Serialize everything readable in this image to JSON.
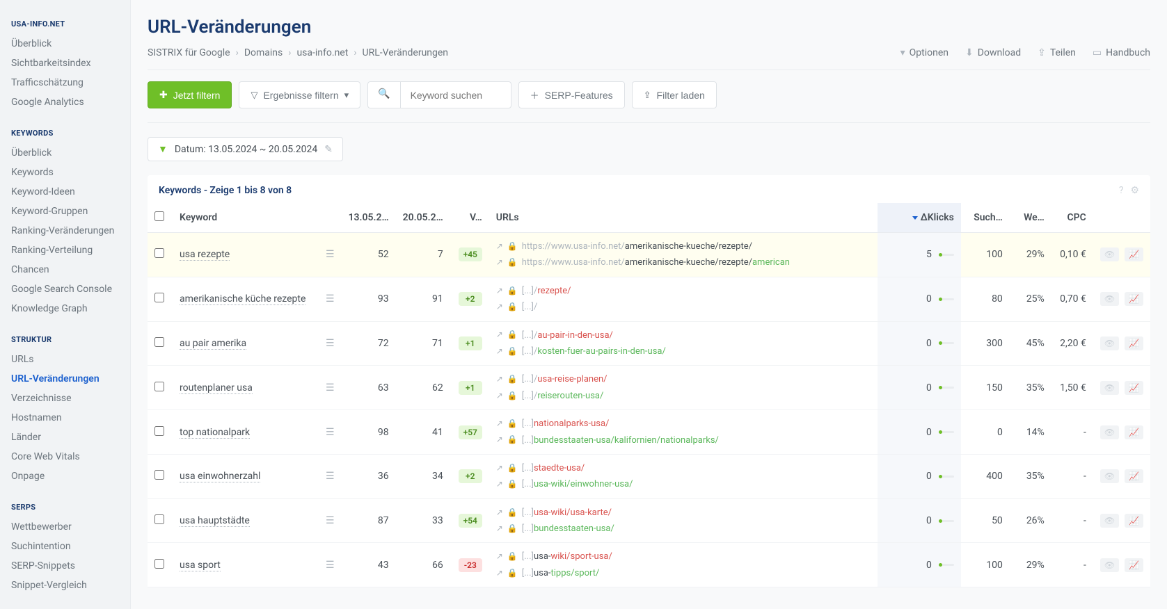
{
  "sidebar": {
    "header": "USA-INFO.NET",
    "sections": [
      {
        "items": [
          "Überblick",
          "Sichtbarkeitsindex",
          "Trafficschätzung",
          "Google Analytics"
        ]
      },
      {
        "header": "KEYWORDS",
        "items": [
          "Überblick",
          "Keywords",
          "Keyword-Ideen",
          "Keyword-Gruppen",
          "Ranking-Veränderungen",
          "Ranking-Verteilung",
          "Chancen",
          "Google Search Console",
          "Knowledge Graph"
        ]
      },
      {
        "header": "STRUKTUR",
        "items": [
          "URLs",
          "URL-Veränderungen",
          "Verzeichnisse",
          "Hostnamen",
          "Länder",
          "Core Web Vitals",
          "Onpage"
        ],
        "active": "URL-Veränderungen"
      },
      {
        "header": "SERPS",
        "items": [
          "Wettbewerber",
          "Suchintention",
          "SERP-Snippets",
          "Snippet-Vergleich"
        ]
      }
    ]
  },
  "page_title": "URL-Veränderungen",
  "breadcrumb": [
    "SISTRIX für Google",
    "Domains",
    "usa-info.net",
    "URL-Veränderungen"
  ],
  "header_actions": {
    "optionen": "Optionen",
    "download": "Download",
    "teilen": "Teilen",
    "handbuch": "Handbuch"
  },
  "toolbar": {
    "jetzt_filtern": "Jetzt filtern",
    "ergebnisse_filtern": "Ergebnisse filtern",
    "search_placeholder": "Keyword suchen",
    "serp_features": "SERP-Features",
    "filter_laden": "Filter laden"
  },
  "date_chip": {
    "label": "Datum: 13.05.2024 ~ 20.05.2024"
  },
  "table": {
    "title": "Keywords - Zeige 1 bis 8 von 8",
    "columns": {
      "keyword": "Keyword",
      "date1": "13.05.2…",
      "date2": "20.05.2…",
      "delta": "V…",
      "urls": "URLs",
      "clicks": "ΔKlicks",
      "such": "Such…",
      "wett": "We…",
      "cpc": "CPC"
    },
    "rows": [
      {
        "keyword": "usa rezepte",
        "d1": "52",
        "d2": "7",
        "delta": "+45",
        "delta_sign": "pos",
        "urls": [
          {
            "prefix": "https://www.usa-info.net/",
            "red": "",
            "mid": "amerikanische-kueche/rezepte/",
            "green": ""
          },
          {
            "prefix": "https://www.usa-info.net/",
            "red": "",
            "mid": "amerikanische-kueche/rezepte/",
            "green": "american"
          }
        ],
        "clicks": "5",
        "such": "100",
        "wett": "29%",
        "cpc": "0,10 €",
        "highlight": true
      },
      {
        "keyword": "amerikanische küche rezepte",
        "d1": "93",
        "d2": "91",
        "delta": "+2",
        "delta_sign": "pos",
        "urls": [
          {
            "prefix": "[...]/",
            "red": "rezepte/",
            "mid": "",
            "green": ""
          },
          {
            "prefix": "[...]/",
            "red": "",
            "mid": "",
            "green": ""
          }
        ],
        "clicks": "0",
        "such": "80",
        "wett": "25%",
        "cpc": "0,70 €"
      },
      {
        "keyword": "au pair amerika",
        "d1": "72",
        "d2": "71",
        "delta": "+1",
        "delta_sign": "pos",
        "urls": [
          {
            "prefix": "[...]/",
            "red": "au-pair-in-den-usa/",
            "mid": "",
            "green": ""
          },
          {
            "prefix": "[...]/",
            "red": "",
            "mid": "",
            "green": "kosten-fuer-au-pairs-in-den-usa/"
          }
        ],
        "clicks": "0",
        "such": "300",
        "wett": "45%",
        "cpc": "2,20 €"
      },
      {
        "keyword": "routenplaner usa",
        "d1": "63",
        "d2": "62",
        "delta": "+1",
        "delta_sign": "pos",
        "urls": [
          {
            "prefix": "[...]/",
            "red": "usa-reise-planen/",
            "mid": "",
            "green": ""
          },
          {
            "prefix": "[...]/",
            "red": "",
            "mid": "",
            "green": "reiserouten-usa/"
          }
        ],
        "clicks": "0",
        "such": "150",
        "wett": "35%",
        "cpc": "1,50 €"
      },
      {
        "keyword": "top nationalpark",
        "d1": "98",
        "d2": "41",
        "delta": "+57",
        "delta_sign": "pos",
        "urls": [
          {
            "prefix": "[...]",
            "red": "nationalparks-usa/",
            "mid": "",
            "green": ""
          },
          {
            "prefix": "[...]",
            "red": "",
            "mid": "",
            "green": "bundesstaaten-usa/kalifornien/nationalparks/"
          }
        ],
        "clicks": "0",
        "such": "0",
        "wett": "14%",
        "cpc": "-"
      },
      {
        "keyword": "usa einwohnerzahl",
        "d1": "36",
        "d2": "34",
        "delta": "+2",
        "delta_sign": "pos",
        "urls": [
          {
            "prefix": "[...]",
            "red": "staedte-usa/",
            "mid": "",
            "green": ""
          },
          {
            "prefix": "[...]",
            "red": "",
            "mid": "",
            "green": "usa-wiki/einwohner-usa/"
          }
        ],
        "clicks": "0",
        "such": "400",
        "wett": "35%",
        "cpc": "-"
      },
      {
        "keyword": "usa hauptstädte",
        "d1": "87",
        "d2": "33",
        "delta": "+54",
        "delta_sign": "pos",
        "urls": [
          {
            "prefix": "[...]",
            "red": "usa-wiki/usa-karte/",
            "mid": "",
            "green": ""
          },
          {
            "prefix": "[...]",
            "red": "",
            "mid": "",
            "green": "bundesstaaten-usa/"
          }
        ],
        "clicks": "0",
        "such": "50",
        "wett": "26%",
        "cpc": "-"
      },
      {
        "keyword": "usa sport",
        "d1": "43",
        "d2": "66",
        "delta": "-23",
        "delta_sign": "neg",
        "urls": [
          {
            "prefix": "[...]",
            "red": "",
            "mid": "usa-",
            "red2": "wiki/sport-usa/",
            "green": ""
          },
          {
            "prefix": "[...]",
            "red": "",
            "mid": "usa-",
            "green": "tipps/sport/"
          }
        ],
        "clicks": "0",
        "such": "100",
        "wett": "29%",
        "cpc": "-"
      }
    ]
  }
}
